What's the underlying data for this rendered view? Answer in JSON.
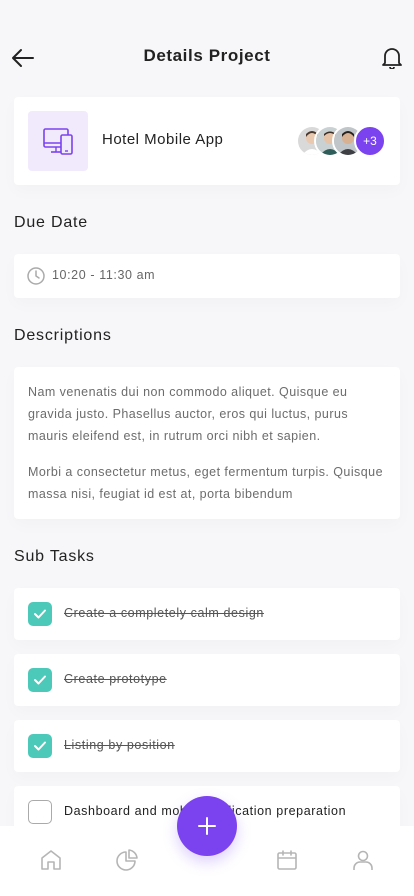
{
  "header": {
    "title": "Details Project"
  },
  "project": {
    "name": "Hotel Mobile App",
    "members_more": "+3"
  },
  "due_date": {
    "section_title": "Due Date",
    "time": "10:20 - 11:30 am"
  },
  "descriptions": {
    "section_title": "Descriptions",
    "paragraphs": [
      "Nam venenatis dui non commodo aliquet. Quisque eu gravida justo. Phasellus auctor, eros qui luctus, purus mauris eleifend est, in rutrum orci nibh et sapien.",
      "Morbi a consectetur metus, eget fermentum turpis. Quisque massa nisi, feugiat id est at, porta bibendum"
    ]
  },
  "sub_tasks": {
    "section_title": "Sub Tasks",
    "items": [
      {
        "label": "Create a completely calm design",
        "done": true
      },
      {
        "label": "Create prototype",
        "done": true
      },
      {
        "label": "Listing by position",
        "done": true
      },
      {
        "label": "Dashboard and mobile application preparation",
        "done": false
      }
    ]
  },
  "colors": {
    "accent": "#7b42f0",
    "check": "#4cc9b8",
    "project_bg": "#f1eafd"
  },
  "icons": [
    "arrow-left-icon",
    "bell-icon",
    "device-icon",
    "clock-icon",
    "check-icon",
    "plus-icon",
    "home-icon",
    "pie-chart-icon",
    "calendar-icon",
    "user-icon"
  ]
}
